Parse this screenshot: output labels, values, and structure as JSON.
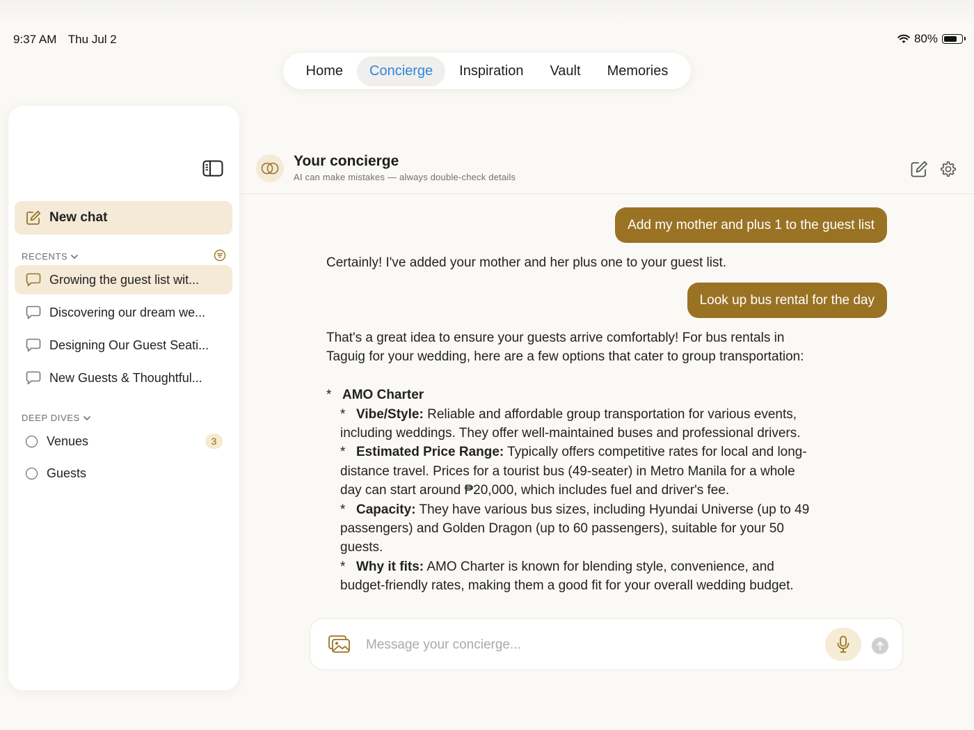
{
  "status_bar": {
    "time": "9:37 AM",
    "date": "Thu Jul 2",
    "battery": "80%",
    "battery_level": 0.8
  },
  "nav": {
    "tabs": [
      {
        "label": "Home",
        "active": false
      },
      {
        "label": "Concierge",
        "active": true
      },
      {
        "label": "Inspiration",
        "active": false
      },
      {
        "label": "Vault",
        "active": false
      },
      {
        "label": "Memories",
        "active": false
      }
    ]
  },
  "sidebar": {
    "new_chat": "New chat",
    "recents_label": "RECENTS",
    "recents": [
      {
        "label": "Growing the guest list wit...",
        "active": true
      },
      {
        "label": "Discovering our dream we...",
        "active": false
      },
      {
        "label": "Designing Our Guest Seati...",
        "active": false
      },
      {
        "label": "New Guests & Thoughtful...",
        "active": false
      }
    ],
    "deep_dives_label": "DEEP DIVES",
    "deep_dives": [
      {
        "label": "Venues",
        "badge": "3"
      },
      {
        "label": "Guests",
        "badge": ""
      }
    ]
  },
  "chat": {
    "title": "Your concierge",
    "subtitle": "AI can make mistakes — always double-check details",
    "messages": {
      "user1": "Add my mother and plus 1 to the guest list",
      "assistant1": "Certainly! I've added your mother and her plus one to your guest list.",
      "user2": "Look up bus rental for the day",
      "assistant2_intro": "That's a great idea to ensure your guests arrive comfortably! For bus rentals in Taguig for your wedding, here are a few options that cater to group transportation:",
      "bullet": "*",
      "option_name": "AMO Charter",
      "details": [
        {
          "label": "Vibe/Style:",
          "text": " Reliable and affordable group transportation for various events, including weddings. They offer well-maintained buses and professional drivers."
        },
        {
          "label": "Estimated Price Range:",
          "text": " Typically offers competitive rates for local and long-distance travel. Prices for a tourist bus (49-seater) in Metro Manila for a whole day can start around ₱20,000, which includes fuel and driver's fee."
        },
        {
          "label": "Capacity:",
          "text": " They have various bus sizes, including Hyundai Universe (up to 49 passengers) and Golden Dragon (up to 60 passengers), suitable for your 50 guests."
        },
        {
          "label": "Why it fits:",
          "text": " AMO Charter is known for blending style, convenience, and budget-friendly rates, making them a good fit for your overall wedding budget."
        }
      ]
    },
    "composer": {
      "placeholder": "Message your concierge..."
    }
  },
  "colors": {
    "accent": "#9a7224",
    "accent_soft": "#f4ead7",
    "link_blue": "#2f86d6"
  },
  "icons": [
    "wifi-icon",
    "battery-icon",
    "sidebar-toggle-icon",
    "compose-icon",
    "filter-icon",
    "chat-bubble-icon",
    "concierge-rings-icon",
    "settings-gear-icon",
    "photo-library-icon",
    "microphone-icon",
    "send-arrow-icon"
  ]
}
